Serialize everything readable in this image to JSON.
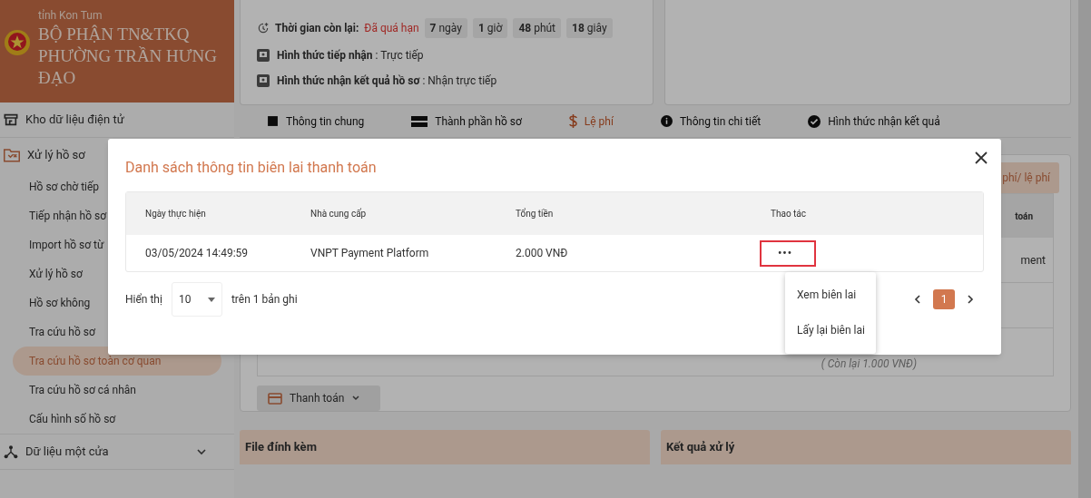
{
  "sidebar": {
    "region": "tỉnh Kon Tum",
    "title": "BỘ PHẬN TN&TKQ PHƯỜNG TRẦN HƯNG ĐẠO",
    "items": [
      {
        "label": "Kho dữ liệu điện tử"
      },
      {
        "label": "Xử lý hồ sơ",
        "children": [
          {
            "label": "Hồ sơ chờ tiếp",
            "selected": false
          },
          {
            "label": "Tiếp nhận hồ sơ",
            "selected": false
          },
          {
            "label": "Import hồ sơ từ",
            "selected": false
          },
          {
            "label": "Xử lý hồ sơ",
            "selected": false
          },
          {
            "label": "Hồ sơ không",
            "selected": false
          },
          {
            "label": "Tra cứu hồ sơ",
            "selected": false
          },
          {
            "label": "Tra cứu hồ sơ toàn cơ quan",
            "selected": true
          },
          {
            "label": "Tra cứu hồ sơ cá nhân",
            "selected": false
          },
          {
            "label": "Cấu hình số hồ sơ",
            "selected": false
          }
        ]
      },
      {
        "label": "Dữ liệu một cửa",
        "expanded": false
      }
    ]
  },
  "info": {
    "deadline_label": "Thời gian còn lại:",
    "deadline_status": "Đã quá hạn",
    "deadline_parts": [
      {
        "value": "7",
        "unit": "ngày"
      },
      {
        "value": "1",
        "unit": "giờ"
      },
      {
        "value": "48",
        "unit": "phút"
      },
      {
        "value": "18",
        "unit": "giây"
      }
    ],
    "rows": [
      {
        "label": "Hình thức tiếp nhận",
        "value": ": Trực tiếp"
      },
      {
        "label": "Hình thức nhận kết quả hồ sơ",
        "value": ": Nhận trực tiếp"
      }
    ]
  },
  "tabs": [
    {
      "label": "Thông tin chung",
      "selected": false
    },
    {
      "label": "Thành phần hồ sơ",
      "selected": false
    },
    {
      "label": "Lệ phí",
      "selected": true
    },
    {
      "label": "Thông tin chi tiết",
      "selected": false
    },
    {
      "label": "Hình thức nhận kết quả",
      "selected": false
    }
  ],
  "fee_panel": {
    "header": "phí/ lệ phí",
    "column": "toán",
    "cell": "ment",
    "remaining": "( Còn lại 1.000 VNĐ)",
    "pay_button": "Thanh toán"
  },
  "sections": [
    "File đính kèm",
    "Kết quả xử lý"
  ],
  "dialog": {
    "title": "Danh sách thông tin biên lai thanh toán",
    "columns": [
      "Ngày thực hiện",
      "Nhà cung cấp",
      "Tổng tiền",
      "Thao tác"
    ],
    "rows": [
      {
        "cells": [
          "03/05/2024 14:49:59",
          "VNPT Payment Platform",
          "2.000 VNĐ"
        ],
        "action": "•••"
      }
    ],
    "menu": [
      "Xem biên lai",
      "Lấy lại biên lai"
    ],
    "show_label": "Hiển thị",
    "page_size": "10",
    "summary": "trên 1 bản ghi",
    "pages": [
      {
        "label": "1",
        "selected": true
      }
    ]
  }
}
